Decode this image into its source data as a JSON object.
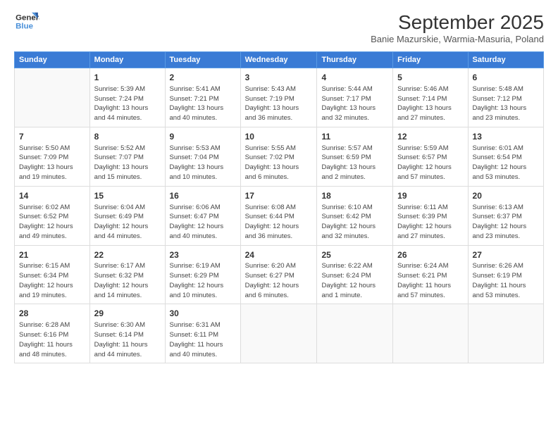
{
  "logo": {
    "line1": "General",
    "line2": "Blue"
  },
  "title": "September 2025",
  "location": "Banie Mazurskie, Warmia-Masuria, Poland",
  "days_of_week": [
    "Sunday",
    "Monday",
    "Tuesday",
    "Wednesday",
    "Thursday",
    "Friday",
    "Saturday"
  ],
  "weeks": [
    [
      {
        "day": "",
        "info": ""
      },
      {
        "day": "1",
        "info": "Sunrise: 5:39 AM\nSunset: 7:24 PM\nDaylight: 13 hours\nand 44 minutes."
      },
      {
        "day": "2",
        "info": "Sunrise: 5:41 AM\nSunset: 7:21 PM\nDaylight: 13 hours\nand 40 minutes."
      },
      {
        "day": "3",
        "info": "Sunrise: 5:43 AM\nSunset: 7:19 PM\nDaylight: 13 hours\nand 36 minutes."
      },
      {
        "day": "4",
        "info": "Sunrise: 5:44 AM\nSunset: 7:17 PM\nDaylight: 13 hours\nand 32 minutes."
      },
      {
        "day": "5",
        "info": "Sunrise: 5:46 AM\nSunset: 7:14 PM\nDaylight: 13 hours\nand 27 minutes."
      },
      {
        "day": "6",
        "info": "Sunrise: 5:48 AM\nSunset: 7:12 PM\nDaylight: 13 hours\nand 23 minutes."
      }
    ],
    [
      {
        "day": "7",
        "info": "Sunrise: 5:50 AM\nSunset: 7:09 PM\nDaylight: 13 hours\nand 19 minutes."
      },
      {
        "day": "8",
        "info": "Sunrise: 5:52 AM\nSunset: 7:07 PM\nDaylight: 13 hours\nand 15 minutes."
      },
      {
        "day": "9",
        "info": "Sunrise: 5:53 AM\nSunset: 7:04 PM\nDaylight: 13 hours\nand 10 minutes."
      },
      {
        "day": "10",
        "info": "Sunrise: 5:55 AM\nSunset: 7:02 PM\nDaylight: 13 hours\nand 6 minutes."
      },
      {
        "day": "11",
        "info": "Sunrise: 5:57 AM\nSunset: 6:59 PM\nDaylight: 13 hours\nand 2 minutes."
      },
      {
        "day": "12",
        "info": "Sunrise: 5:59 AM\nSunset: 6:57 PM\nDaylight: 12 hours\nand 57 minutes."
      },
      {
        "day": "13",
        "info": "Sunrise: 6:01 AM\nSunset: 6:54 PM\nDaylight: 12 hours\nand 53 minutes."
      }
    ],
    [
      {
        "day": "14",
        "info": "Sunrise: 6:02 AM\nSunset: 6:52 PM\nDaylight: 12 hours\nand 49 minutes."
      },
      {
        "day": "15",
        "info": "Sunrise: 6:04 AM\nSunset: 6:49 PM\nDaylight: 12 hours\nand 44 minutes."
      },
      {
        "day": "16",
        "info": "Sunrise: 6:06 AM\nSunset: 6:47 PM\nDaylight: 12 hours\nand 40 minutes."
      },
      {
        "day": "17",
        "info": "Sunrise: 6:08 AM\nSunset: 6:44 PM\nDaylight: 12 hours\nand 36 minutes."
      },
      {
        "day": "18",
        "info": "Sunrise: 6:10 AM\nSunset: 6:42 PM\nDaylight: 12 hours\nand 32 minutes."
      },
      {
        "day": "19",
        "info": "Sunrise: 6:11 AM\nSunset: 6:39 PM\nDaylight: 12 hours\nand 27 minutes."
      },
      {
        "day": "20",
        "info": "Sunrise: 6:13 AM\nSunset: 6:37 PM\nDaylight: 12 hours\nand 23 minutes."
      }
    ],
    [
      {
        "day": "21",
        "info": "Sunrise: 6:15 AM\nSunset: 6:34 PM\nDaylight: 12 hours\nand 19 minutes."
      },
      {
        "day": "22",
        "info": "Sunrise: 6:17 AM\nSunset: 6:32 PM\nDaylight: 12 hours\nand 14 minutes."
      },
      {
        "day": "23",
        "info": "Sunrise: 6:19 AM\nSunset: 6:29 PM\nDaylight: 12 hours\nand 10 minutes."
      },
      {
        "day": "24",
        "info": "Sunrise: 6:20 AM\nSunset: 6:27 PM\nDaylight: 12 hours\nand 6 minutes."
      },
      {
        "day": "25",
        "info": "Sunrise: 6:22 AM\nSunset: 6:24 PM\nDaylight: 12 hours\nand 1 minute."
      },
      {
        "day": "26",
        "info": "Sunrise: 6:24 AM\nSunset: 6:21 PM\nDaylight: 11 hours\nand 57 minutes."
      },
      {
        "day": "27",
        "info": "Sunrise: 6:26 AM\nSunset: 6:19 PM\nDaylight: 11 hours\nand 53 minutes."
      }
    ],
    [
      {
        "day": "28",
        "info": "Sunrise: 6:28 AM\nSunset: 6:16 PM\nDaylight: 11 hours\nand 48 minutes."
      },
      {
        "day": "29",
        "info": "Sunrise: 6:30 AM\nSunset: 6:14 PM\nDaylight: 11 hours\nand 44 minutes."
      },
      {
        "day": "30",
        "info": "Sunrise: 6:31 AM\nSunset: 6:11 PM\nDaylight: 11 hours\nand 40 minutes."
      },
      {
        "day": "",
        "info": ""
      },
      {
        "day": "",
        "info": ""
      },
      {
        "day": "",
        "info": ""
      },
      {
        "day": "",
        "info": ""
      }
    ]
  ]
}
